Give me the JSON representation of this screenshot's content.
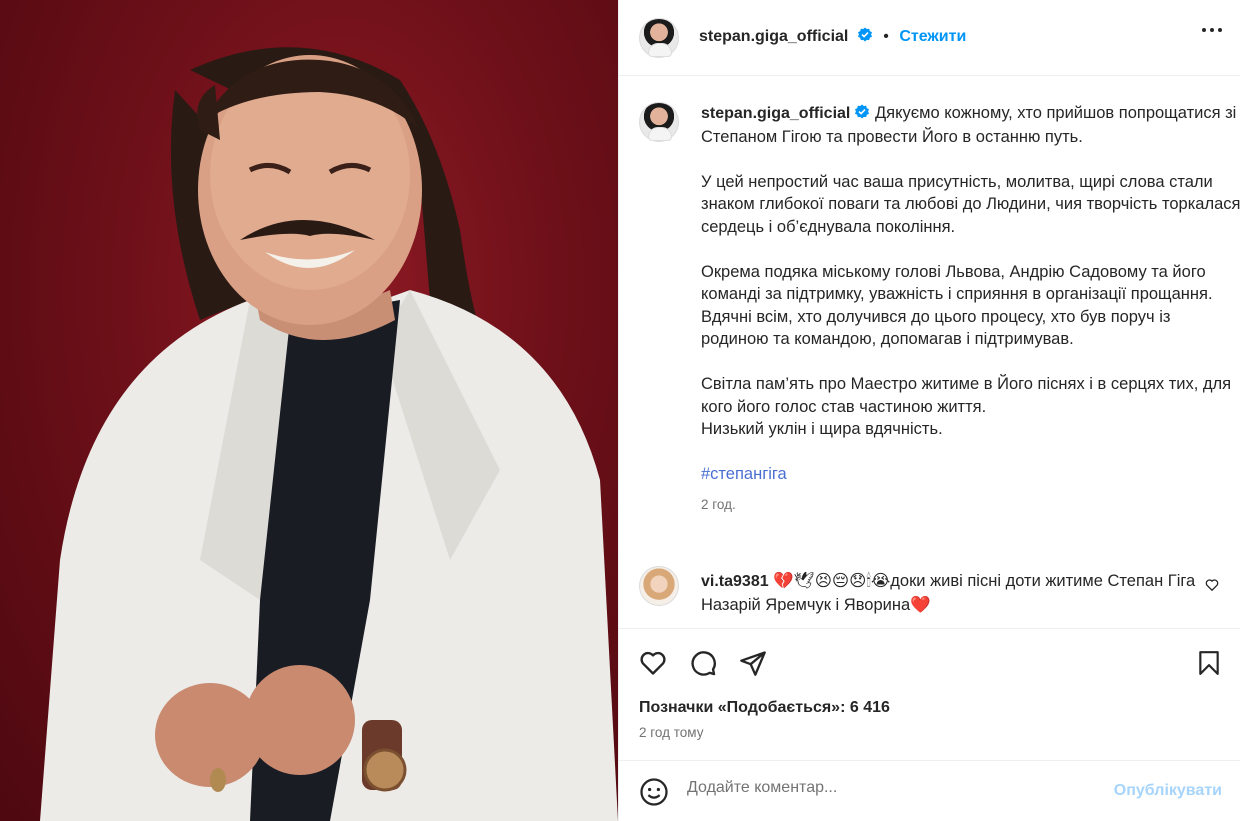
{
  "post": {
    "author": "stepan.giga_official",
    "separator": "•",
    "follow_label": "Стежити",
    "caption": {
      "author": "stepan.giga_official",
      "paragraphs": [
        "Дякуємо кожному, хто прийшов попрощатися зі Степаном Гігою та провести Його в останню путь.",
        "У цей непростий час ваша присутність, молитва, щирі слова стали знаком глибокої поваги та любові до Людини, чия творчість торкалася сердець і об’єднувала покоління.",
        "Окрема подяка міському голові Львова, Андрію Садовому та його команді за підтримку, уважність і сприяння в організації прощання. Вдячні всім, хто долучився до цього процесу, хто був поруч із родиною та командою, допомагав і підтримував.",
        "Світла пам’ять про Маестро житиме в Його піснях і в серцях тих, для кого його голос став частиною життя."
      ],
      "last_line": "Низький уклін і щира вдячність.",
      "hashtag": "#степангіга",
      "time": "2 год."
    },
    "comment": {
      "author": "vi.ta9381",
      "text": "💔🕊😣😔😞🕯😭доки живі пісні доти житиме Степан Гіга Назарій Яремчук і Яворина❤️"
    },
    "likes": "Позначки «Подобається»: 6 416",
    "posted_ago": "2 год тому",
    "add_comment": {
      "placeholder": "Додайте коментар...",
      "publish_label": "Опублікувати"
    }
  },
  "colors": {
    "accent": "#0095f6",
    "publish_disabled": "#a6d4fb",
    "photo_background": "#6e1019"
  },
  "icons": [
    "verified-badge-icon",
    "more-options-icon",
    "heart-icon",
    "comment-icon",
    "share-icon",
    "bookmark-icon",
    "emoji-icon"
  ]
}
